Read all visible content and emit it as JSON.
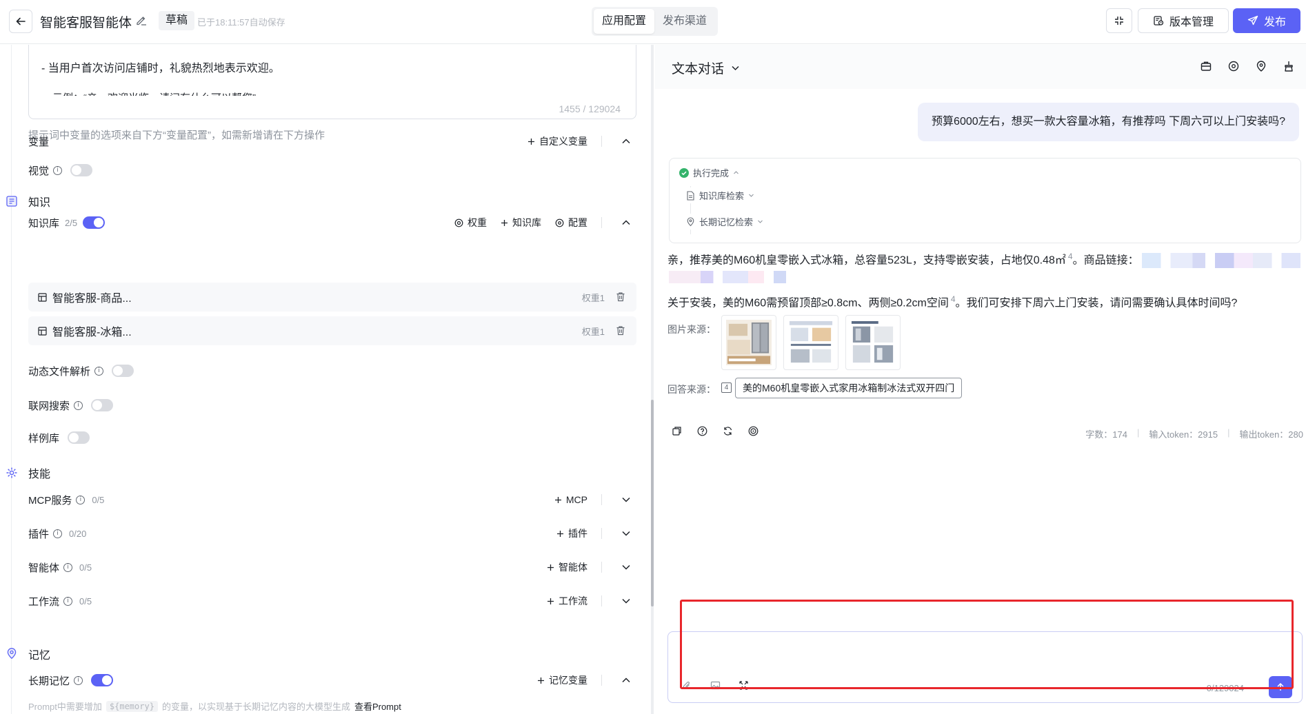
{
  "topbar": {
    "title": "智能客服智能体",
    "status_tag": "草稿",
    "autosave_text": "已于18:11:57自动保存",
    "tabs": [
      {
        "label": "应用配置",
        "active": true
      },
      {
        "label": "发布渠道",
        "active": false
      }
    ],
    "version_button": "版本管理",
    "publish_button": "发布",
    "accent_color": "#5b62f5"
  },
  "left": {
    "prompt": {
      "line1": "- 当用户首次访问店铺时，礼貌热烈地表示欢迎。",
      "line2": "示例：“亲，欢迎光临，请问有什么可以帮您”",
      "count": "1455 / 129024"
    },
    "prompt_hint": "提示词中变量的选项来自下方“变量配置”，如需新增请在下方操作",
    "variables": {
      "label": "变量",
      "add_label": "自定义变量"
    },
    "vision": {
      "label": "视觉",
      "enabled": false
    },
    "knowledge": {
      "section_title": "知识",
      "kb_label": "知识库",
      "kb_count": "2/5",
      "kb_enabled": true,
      "actions": {
        "weight": "权重",
        "add_kb": "知识库",
        "config": "配置"
      },
      "items": [
        {
          "name": "智能客服-商品...",
          "weight": "权重1"
        },
        {
          "name": "智能客服-冰箱...",
          "weight": "权重1"
        }
      ],
      "dynamic_parse": {
        "label": "动态文件解析",
        "enabled": false
      },
      "web_search": {
        "label": "联网搜索",
        "enabled": false
      },
      "examples": {
        "label": "样例库",
        "enabled": false
      }
    },
    "skills": {
      "section_title": "技能",
      "rows": [
        {
          "label": "MCP服务",
          "count": "0/5",
          "add": "MCP"
        },
        {
          "label": "插件",
          "count": "0/20",
          "add": "插件"
        },
        {
          "label": "智能体",
          "count": "0/5",
          "add": "智能体"
        },
        {
          "label": "工作流",
          "count": "0/5",
          "add": "工作流"
        }
      ]
    },
    "memory": {
      "section_title": "记忆",
      "long_term_label": "长期记忆",
      "long_term_enabled": true,
      "add_label": "记忆变量",
      "hint_prefix": "Prompt中需要增加",
      "hint_code": "${memory}",
      "hint_suffix": "的变量，以实现基于长期记忆内容的大模型生成",
      "hint_link": "查看Prompt"
    }
  },
  "right": {
    "mode_label": "文本对话",
    "user_message": "预算6000左右，想买一款大容量冰箱，有推荐吗 下周六可以上门安装吗?",
    "exec": {
      "status": "执行完成",
      "steps": [
        "知识库检索",
        "长期记忆检索"
      ]
    },
    "answer_line1": "亲，推荐美的M60机皇零嵌入式冰箱，总容量523L，支持零嵌安装，占地仅0.48㎡",
    "answer_line1_ref": "4",
    "answer_line1_tail": "。商品链接：",
    "answer_line2": "关于安装，美的M60需预留顶部≥0.8cm、两侧≥0.2cm空间",
    "answer_line2_ref": "4",
    "answer_line2_tail": "。我们可安排下周六上门安装，请问需要确认具体时间吗?",
    "image_source_label": "图片来源：",
    "answer_source_label": "回答来源：",
    "answer_source_num": "4",
    "answer_source_title": "美的M60机皇零嵌入式家用冰箱制冰法式双开四门",
    "stats": {
      "chars": "字数：174",
      "input_tokens": "输入token：2915",
      "output_tokens": "输出token：280"
    },
    "composer": {
      "placeholder": "",
      "count": "0/129024"
    },
    "highlight_color": "#e8262b"
  }
}
